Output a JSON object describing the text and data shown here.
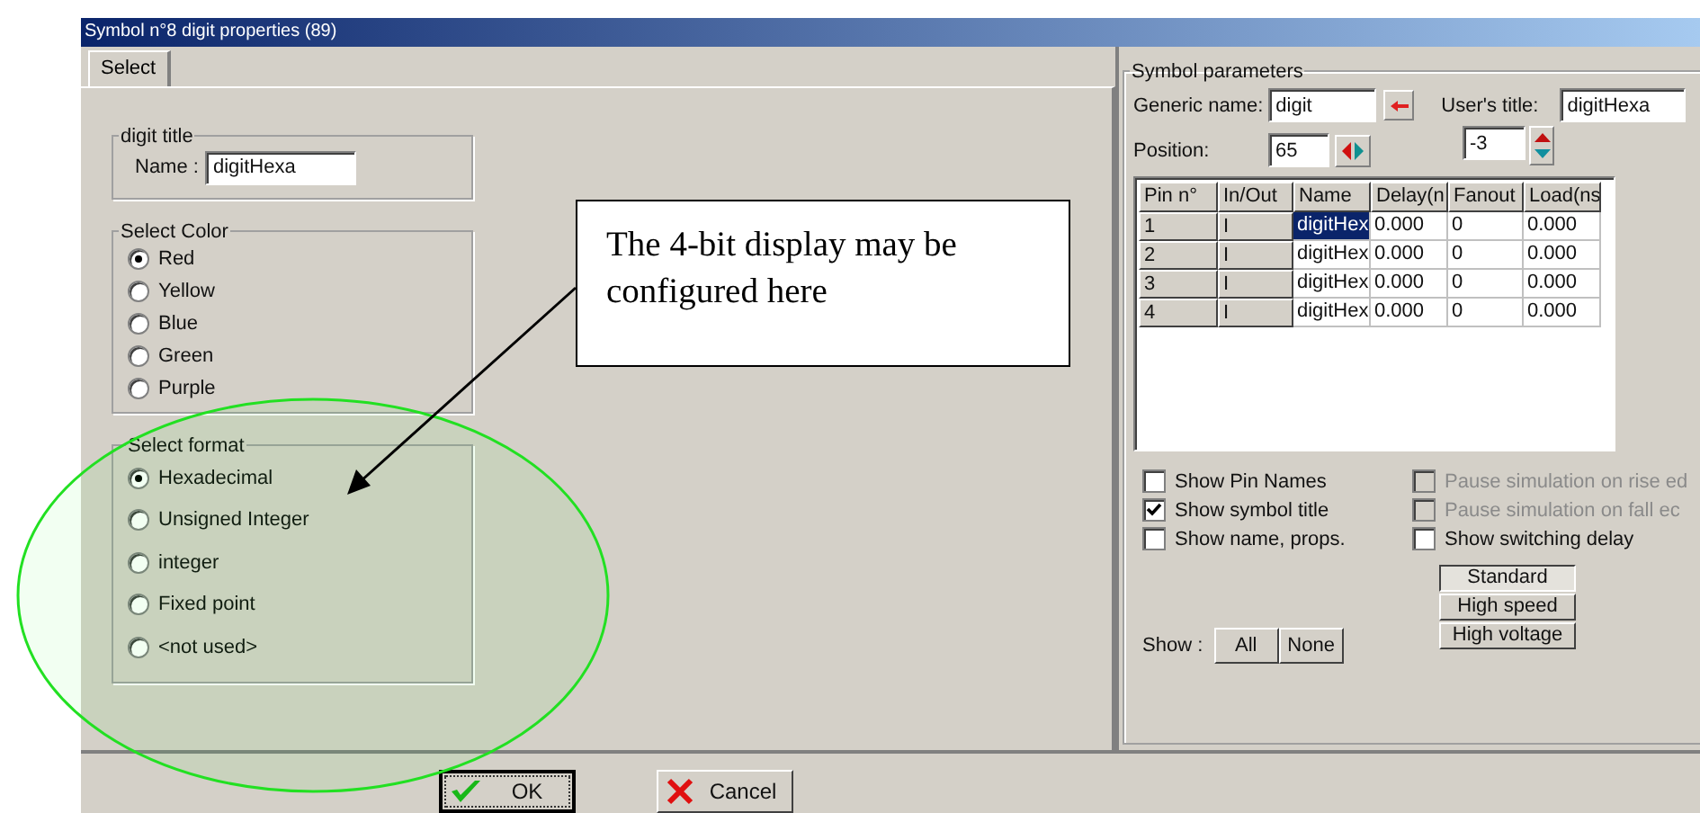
{
  "window": {
    "title": "Symbol n°8 digit properties (89)"
  },
  "tabs": [
    {
      "label": "Select",
      "selected": true
    }
  ],
  "digit_title": {
    "legend": "digit title",
    "name_label": "Name :",
    "name_value": "digitHexa"
  },
  "select_color": {
    "legend": "Select Color",
    "options": [
      {
        "label": "Red",
        "selected": true
      },
      {
        "label": "Yellow",
        "selected": false
      },
      {
        "label": "Blue",
        "selected": false
      },
      {
        "label": "Green",
        "selected": false
      },
      {
        "label": "Purple",
        "selected": false
      }
    ]
  },
  "select_format": {
    "legend": "Select format",
    "options": [
      {
        "label": "Hexadecimal",
        "selected": true
      },
      {
        "label": "Unsigned Integer",
        "selected": false
      },
      {
        "label": "integer",
        "selected": false
      },
      {
        "label": "Fixed point",
        "selected": false
      },
      {
        "label": "<not used>",
        "selected": false
      }
    ]
  },
  "symbol_parameters": {
    "legend": "Symbol parameters",
    "generic_name_label": "Generic name:",
    "generic_name_value": "digit",
    "users_title_label": "User's title:",
    "users_title_value": "digitHexa",
    "position_label": "Position:",
    "position_value": "65",
    "offset_value": "-3",
    "table": {
      "columns": [
        "Pin n°",
        "In/Out",
        "Name",
        "Delay(n",
        "Fanout",
        "Load(ns"
      ],
      "rows": [
        {
          "cells": [
            "1",
            "I",
            "digitHex",
            "0.000",
            "0",
            "0.000"
          ],
          "selected": true
        },
        {
          "cells": [
            "2",
            "I",
            "digitHex",
            "0.000",
            "0",
            "0.000"
          ],
          "selected": false
        },
        {
          "cells": [
            "3",
            "I",
            "digitHex",
            "0.000",
            "0",
            "0.000"
          ],
          "selected": false
        },
        {
          "cells": [
            "4",
            "I",
            "digitHex",
            "0.000",
            "0",
            "0.000"
          ],
          "selected": false
        }
      ]
    }
  },
  "checkboxes_left": [
    {
      "label": "Show Pin Names",
      "checked": false,
      "disabled": false
    },
    {
      "label": "Show symbol title",
      "checked": true,
      "disabled": false
    },
    {
      "label": "Show name, props.",
      "checked": false,
      "disabled": false
    }
  ],
  "checkboxes_right": [
    {
      "label": "Pause simulation on rise ed",
      "checked": false,
      "disabled": true
    },
    {
      "label": "Pause simulation on fall ec",
      "checked": false,
      "disabled": true
    },
    {
      "label": "Show switching delay",
      "checked": false,
      "disabled": false
    }
  ],
  "speed_buttons": [
    {
      "label": "Standard",
      "selected": true
    },
    {
      "label": "High speed",
      "selected": false
    },
    {
      "label": "High voltage",
      "selected": false
    }
  ],
  "show": {
    "label": "Show :",
    "buttons": [
      "All",
      "None"
    ]
  },
  "buttons": [
    {
      "label": "OK",
      "kind": "ok"
    },
    {
      "label": "Cancel",
      "kind": "cancel"
    }
  ],
  "annotation": {
    "text": "The 4-bit display may be configured here"
  }
}
